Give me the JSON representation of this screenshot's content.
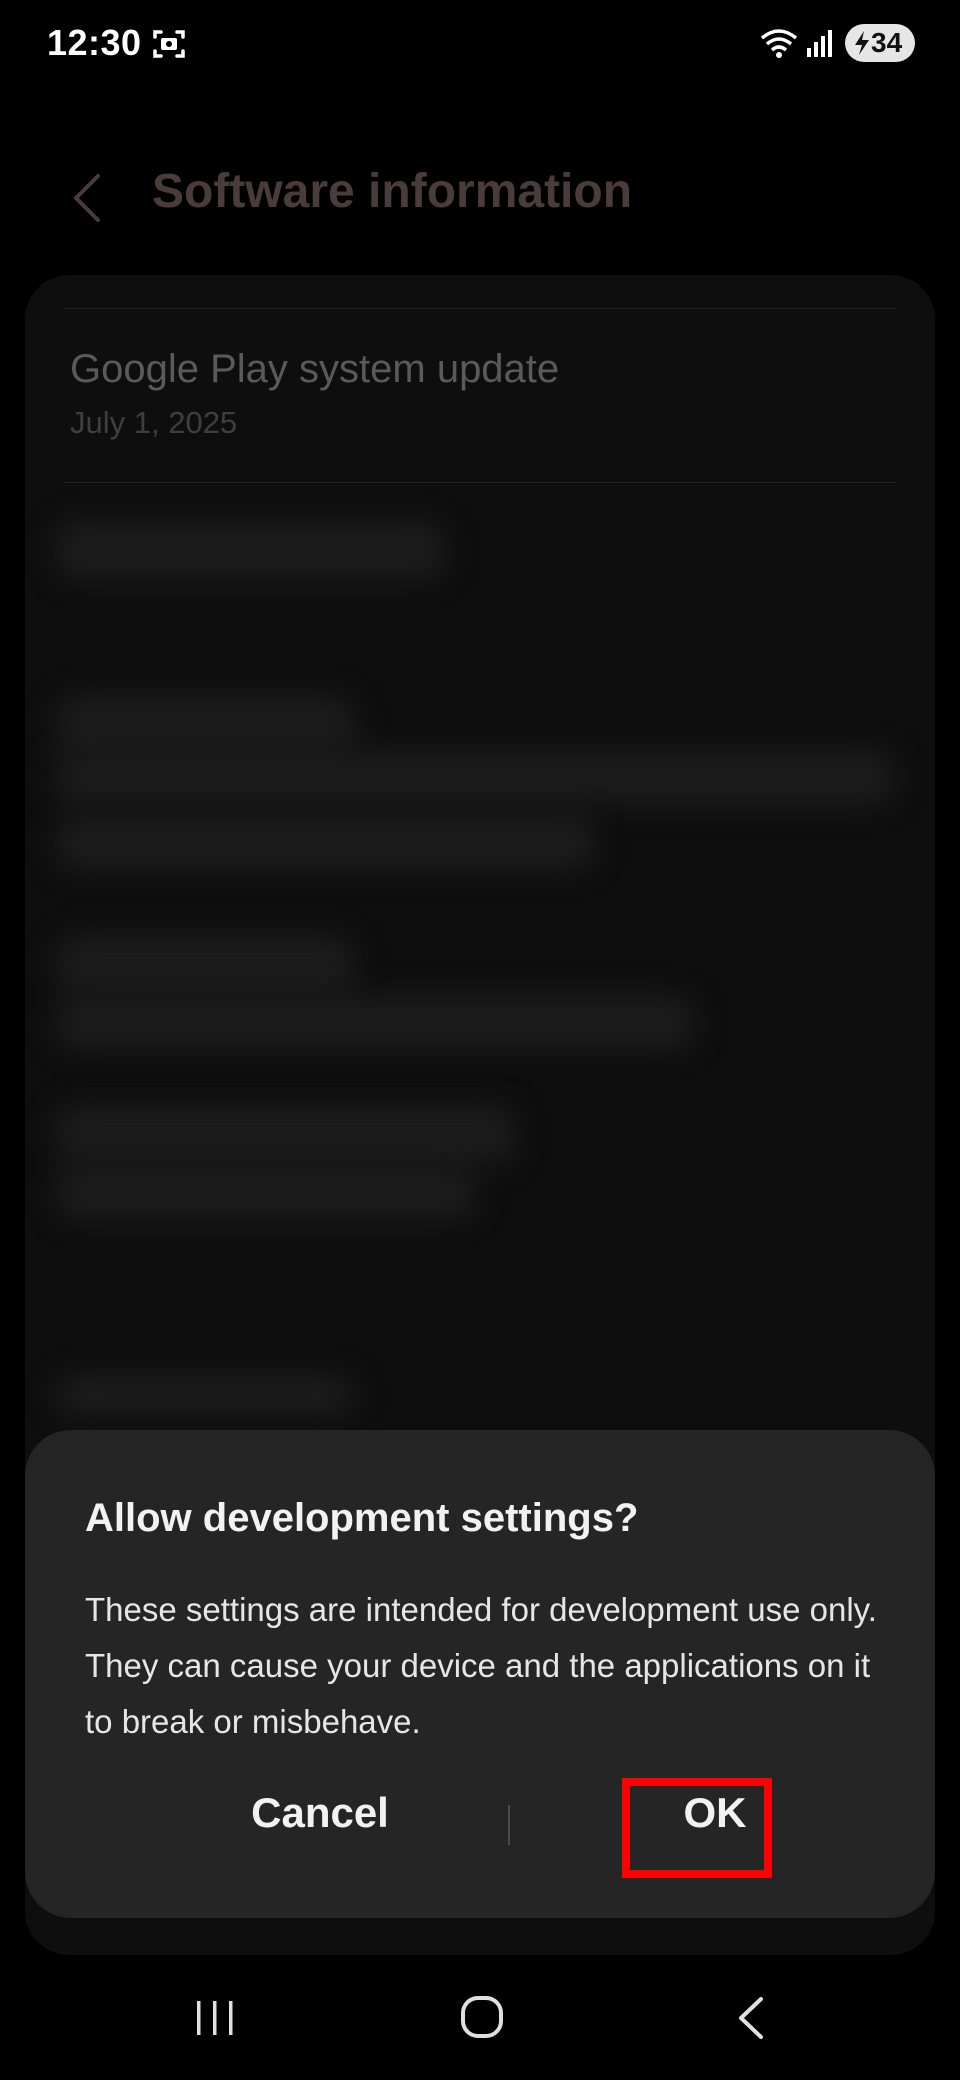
{
  "status_bar": {
    "time": "12:30",
    "battery_level": "34",
    "icons": [
      "screenshot-icon",
      "wifi-icon",
      "signal-icon",
      "battery-charging-icon"
    ]
  },
  "header": {
    "title": "Software information"
  },
  "list": {
    "items": [
      {
        "title": "Google Play system update",
        "subtitle": "July 1, 2025"
      }
    ]
  },
  "dialog": {
    "title": "Allow development settings?",
    "body": "These settings are intended for development use only. They can cause your device and the applications on it to break or misbehave.",
    "cancel_label": "Cancel",
    "ok_label": "OK",
    "highlight_color": "#ff0000"
  },
  "nav_bar": {
    "icons": [
      "recents-icon",
      "home-icon",
      "back-icon"
    ]
  },
  "colors": {
    "background": "#000000",
    "dialog_bg": "#252525",
    "title_dim": "#4a3c3b"
  }
}
